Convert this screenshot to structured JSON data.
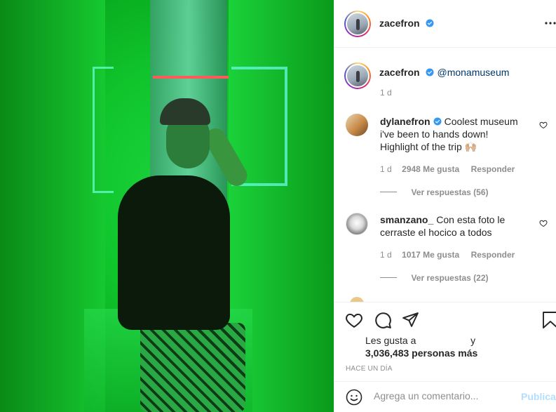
{
  "header": {
    "username": "zacefron",
    "options_icon": "more-horizontal-icon"
  },
  "caption": {
    "username": "zacefron",
    "mention": "@monamuseum",
    "time": "1 d"
  },
  "comments": [
    {
      "username": "dylanefron",
      "verified": true,
      "text": "Coolest museum i've been to hands down! Highlight of the trip 🙌🏼",
      "time": "1 d",
      "likes": "2948 Me gusta",
      "reply_label": "Responder",
      "view_replies": "Ver respuestas (56)"
    },
    {
      "username": "smanzano_",
      "verified": false,
      "text": "Con esta foto le cerraste el hocico a todos",
      "time": "1 d",
      "likes": "1017 Me gusta",
      "reply_label": "Responder",
      "view_replies": "Ver respuestas (22)"
    }
  ],
  "likes": {
    "prefix": "Les gusta a",
    "connector": "y",
    "others": "3,036,483 personas más"
  },
  "post_time": "HACE UN DÍA",
  "comment_box": {
    "placeholder": "Agrega un comentario...",
    "publish_label": "Publicar"
  },
  "colors": {
    "verified": "#3897f0",
    "link": "#00376b",
    "muted": "#8e8e8e",
    "publish_disabled": "#b2dffc"
  }
}
